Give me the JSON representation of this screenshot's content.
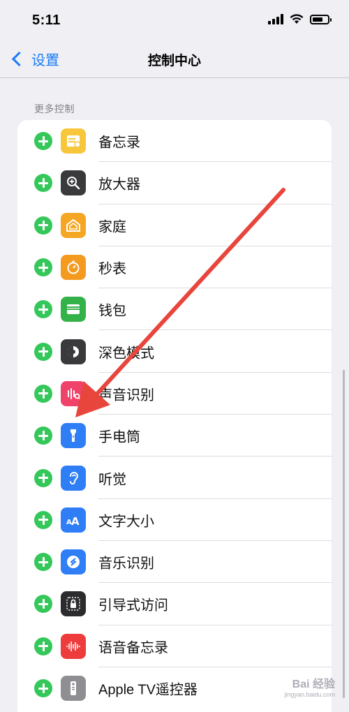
{
  "status_bar": {
    "time": "5:11"
  },
  "nav": {
    "back_label": "设置",
    "title": "控制中心"
  },
  "section": {
    "header": "更多控制"
  },
  "controls": [
    {
      "label": "备忘录",
      "icon": "notes-icon",
      "color": "#f7c63a"
    },
    {
      "label": "放大器",
      "icon": "magnifier-icon",
      "color": "#3a3a3c"
    },
    {
      "label": "家庭",
      "icon": "home-icon",
      "color": "#f5a623"
    },
    {
      "label": "秒表",
      "icon": "stopwatch-icon",
      "color": "#f39a1f"
    },
    {
      "label": "钱包",
      "icon": "wallet-icon",
      "color": "#34b24a"
    },
    {
      "label": "深色模式",
      "icon": "dark-mode-icon",
      "color": "#3a3a3c"
    },
    {
      "label": "声音识别",
      "icon": "sound-recognition-icon",
      "color": "#f0436a"
    },
    {
      "label": "手电筒",
      "icon": "flashlight-icon",
      "color": "#2f7ef6"
    },
    {
      "label": "听觉",
      "icon": "hearing-icon",
      "color": "#2f7ef6"
    },
    {
      "label": "文字大小",
      "icon": "text-size-icon",
      "color": "#2f7ef6"
    },
    {
      "label": "音乐识别",
      "icon": "shazam-icon",
      "color": "#2f7ef6"
    },
    {
      "label": "引导式访问",
      "icon": "guided-access-icon",
      "color": "#2c2c2e"
    },
    {
      "label": "语音备忘录",
      "icon": "voice-memos-icon",
      "color": "#ee3b3b"
    },
    {
      "label": "Apple TV遥控器",
      "icon": "apple-tv-remote-icon",
      "color": "#8e8e93"
    }
  ],
  "watermark": {
    "text": "Bai 经验",
    "sub": "jingyan.baidu.com"
  },
  "colors": {
    "accent": "#1a7cf5",
    "add": "#34c759",
    "annotation_arrow": "#e8453c"
  }
}
